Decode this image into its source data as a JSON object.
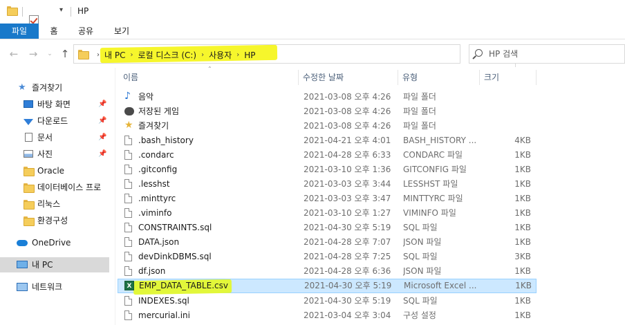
{
  "window": {
    "title": "HP"
  },
  "ribbon": {
    "tabs": [
      "파일",
      "홈",
      "공유",
      "보기"
    ]
  },
  "address": {
    "crumbs": [
      "내 PC",
      "로컬 디스크 (C:)",
      "사용자",
      "HP"
    ]
  },
  "search": {
    "placeholder": "HP 검색"
  },
  "sidebar": {
    "quick_access": "즐겨찾기",
    "items": [
      {
        "label": "바탕 화면",
        "icon": "desktop-icon",
        "pinned": true
      },
      {
        "label": "다운로드",
        "icon": "download-icon",
        "pinned": true
      },
      {
        "label": "문서",
        "icon": "documents-icon",
        "pinned": true
      },
      {
        "label": "사진",
        "icon": "pictures-icon",
        "pinned": true
      },
      {
        "label": "Oracle",
        "icon": "folder-icon",
        "pinned": false
      },
      {
        "label": "데이터베이스 프로",
        "icon": "folder-icon",
        "pinned": false
      },
      {
        "label": "리눅스",
        "icon": "folder-icon",
        "pinned": false
      },
      {
        "label": "환경구성",
        "icon": "folder-icon",
        "pinned": false
      }
    ],
    "onedrive": "OneDrive",
    "this_pc": "내 PC",
    "network": "네트워크"
  },
  "columns": {
    "name": "이름",
    "date": "수정한 날짜",
    "type": "유형",
    "size": "크기"
  },
  "files": [
    {
      "name": "음악",
      "date": "2021-03-08 오후 4:26",
      "type": "파일 폴더",
      "size": "",
      "icon": "music-icon"
    },
    {
      "name": "저장된 게임",
      "date": "2021-03-08 오후 4:26",
      "type": "파일 폴더",
      "size": "",
      "icon": "saved-games-icon"
    },
    {
      "name": "즐겨찾기",
      "date": "2021-03-08 오후 4:26",
      "type": "파일 폴더",
      "size": "",
      "icon": "favorites-icon"
    },
    {
      "name": ".bash_history",
      "date": "2021-04-21 오후 4:01",
      "type": "BASH_HISTORY ...",
      "size": "4KB",
      "icon": "file-icon"
    },
    {
      "name": ".condarc",
      "date": "2021-04-28 오후 6:33",
      "type": "CONDARC 파일",
      "size": "1KB",
      "icon": "file-icon"
    },
    {
      "name": ".gitconfig",
      "date": "2021-03-10 오후 1:36",
      "type": "GITCONFIG 파일",
      "size": "1KB",
      "icon": "file-icon"
    },
    {
      "name": ".lesshst",
      "date": "2021-03-03 오후 3:44",
      "type": "LESSHST 파일",
      "size": "1KB",
      "icon": "file-icon"
    },
    {
      "name": ".minttyrc",
      "date": "2021-03-03 오후 3:47",
      "type": "MINTTYRC 파일",
      "size": "1KB",
      "icon": "file-icon"
    },
    {
      "name": ".viminfo",
      "date": "2021-03-10 오후 1:27",
      "type": "VIMINFO 파일",
      "size": "1KB",
      "icon": "file-icon"
    },
    {
      "name": "CONSTRAINTS.sql",
      "date": "2021-04-30 오후 5:19",
      "type": "SQL 파일",
      "size": "1KB",
      "icon": "file-icon"
    },
    {
      "name": "DATA.json",
      "date": "2021-04-28 오후 7:07",
      "type": "JSON 파일",
      "size": "1KB",
      "icon": "file-icon"
    },
    {
      "name": "devDinkDBMS.sql",
      "date": "2021-04-28 오후 7:25",
      "type": "SQL 파일",
      "size": "3KB",
      "icon": "file-icon"
    },
    {
      "name": "df.json",
      "date": "2021-04-28 오후 6:36",
      "type": "JSON 파일",
      "size": "1KB",
      "icon": "file-icon"
    },
    {
      "name": "EMP_DATA_TABLE.csv",
      "date": "2021-04-30 오후 5:19",
      "type": "Microsoft Excel ...",
      "size": "1KB",
      "icon": "excel-icon",
      "selected": true
    },
    {
      "name": "INDEXES.sql",
      "date": "2021-04-30 오후 5:19",
      "type": "SQL 파일",
      "size": "1KB",
      "icon": "file-icon"
    },
    {
      "name": "mercurial.ini",
      "date": "2021-03-04 오후 3:04",
      "type": "구성 설정",
      "size": "1KB",
      "icon": "config-file-icon"
    }
  ]
}
